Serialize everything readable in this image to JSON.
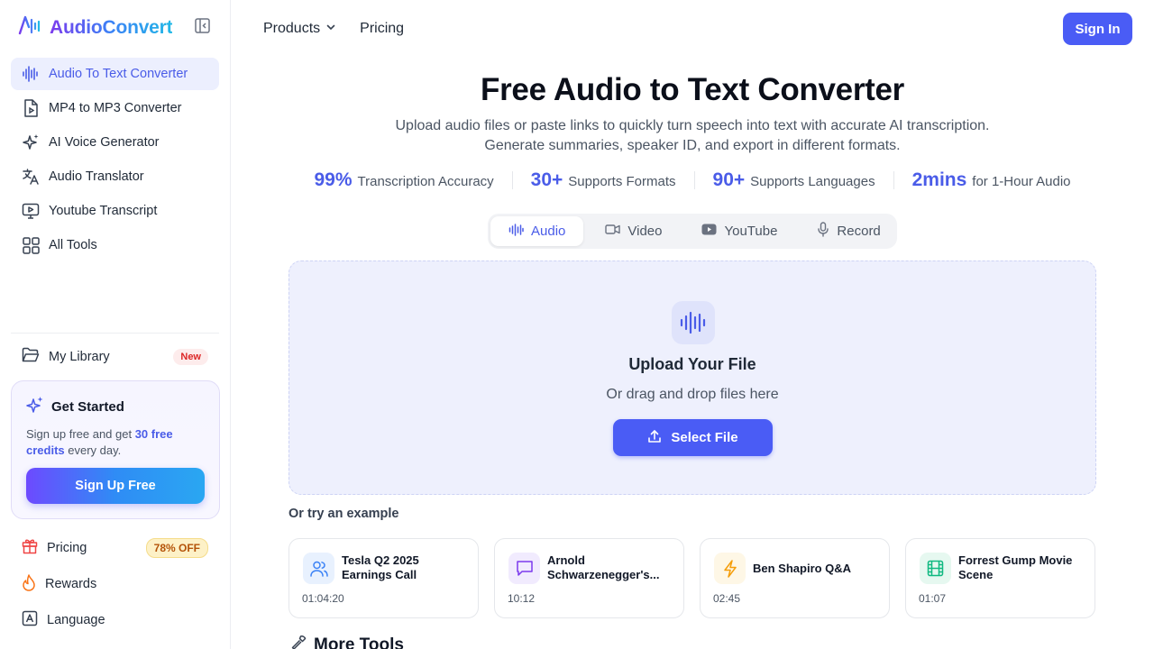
{
  "brand": {
    "name": "AudioConvert",
    "accent": "#4a5cf5"
  },
  "sidebar": {
    "items": [
      {
        "label": "Audio To Text Converter",
        "icon": "audio-wave-icon",
        "active": true
      },
      {
        "label": "MP4 to MP3 Converter",
        "icon": "file-music-icon"
      },
      {
        "label": "AI Voice Generator",
        "icon": "sparkles-icon"
      },
      {
        "label": "Audio Translator",
        "icon": "translate-icon"
      },
      {
        "label": "Youtube Transcript",
        "icon": "monitor-play-icon"
      },
      {
        "label": "All Tools",
        "icon": "grid-icon"
      }
    ],
    "library": {
      "label": "My Library",
      "badge": "New"
    },
    "get_started": {
      "title": "Get Started",
      "text_before": "Sign up free and get ",
      "text_bold": "30 free credits",
      "text_after": " every day.",
      "button": "Sign Up Free"
    },
    "bottom": [
      {
        "label": "Pricing",
        "icon": "gift-icon",
        "badge": "78% OFF"
      },
      {
        "label": "Rewards",
        "icon": "flame-icon"
      },
      {
        "label": "Language",
        "icon": "language-icon"
      }
    ]
  },
  "header": {
    "products": "Products",
    "pricing": "Pricing",
    "sign_in": "Sign In"
  },
  "hero": {
    "title": "Free Audio to Text Converter",
    "subtitle_line1": "Upload audio files or paste links to quickly turn speech into text with accurate AI transcription.",
    "subtitle_line2": "Generate summaries, speaker ID, and export in different formats."
  },
  "stats": [
    {
      "num": "99%",
      "label": "Transcription Accuracy"
    },
    {
      "num": "30+",
      "label": "Supports Formats"
    },
    {
      "num": "90+",
      "label": "Supports Languages"
    },
    {
      "num": "2mins",
      "label": "for 1-Hour Audio"
    }
  ],
  "tabs": [
    {
      "label": "Audio",
      "icon": "audio-wave-icon",
      "active": true
    },
    {
      "label": "Video",
      "icon": "video-camera-icon"
    },
    {
      "label": "YouTube",
      "icon": "youtube-icon"
    },
    {
      "label": "Record",
      "icon": "microphone-icon"
    }
  ],
  "upload": {
    "title": "Upload Your File",
    "subtitle": "Or drag and drop files here",
    "button": "Select File"
  },
  "examples": {
    "label": "Or try an example",
    "items": [
      {
        "title": "Tesla Q2 2025 Earnings Call",
        "duration": "01:04:20",
        "icon": "users-icon",
        "color": "#3b82f6",
        "bg": "#e8f1fe"
      },
      {
        "title": "Arnold Schwarzenegger's...",
        "duration": "10:12",
        "icon": "message-square-icon",
        "color": "#7c3aed",
        "bg": "#f1ebfe"
      },
      {
        "title": "Ben Shapiro Q&A",
        "duration": "02:45",
        "icon": "lightning-icon",
        "color": "#f59e0b",
        "bg": "#fef7e6"
      },
      {
        "title": "Forrest Gump Movie Scene",
        "duration": "01:07",
        "icon": "film-icon",
        "color": "#10b981",
        "bg": "#e6f8f0"
      }
    ]
  },
  "more_tools": {
    "title": "More Tools"
  }
}
